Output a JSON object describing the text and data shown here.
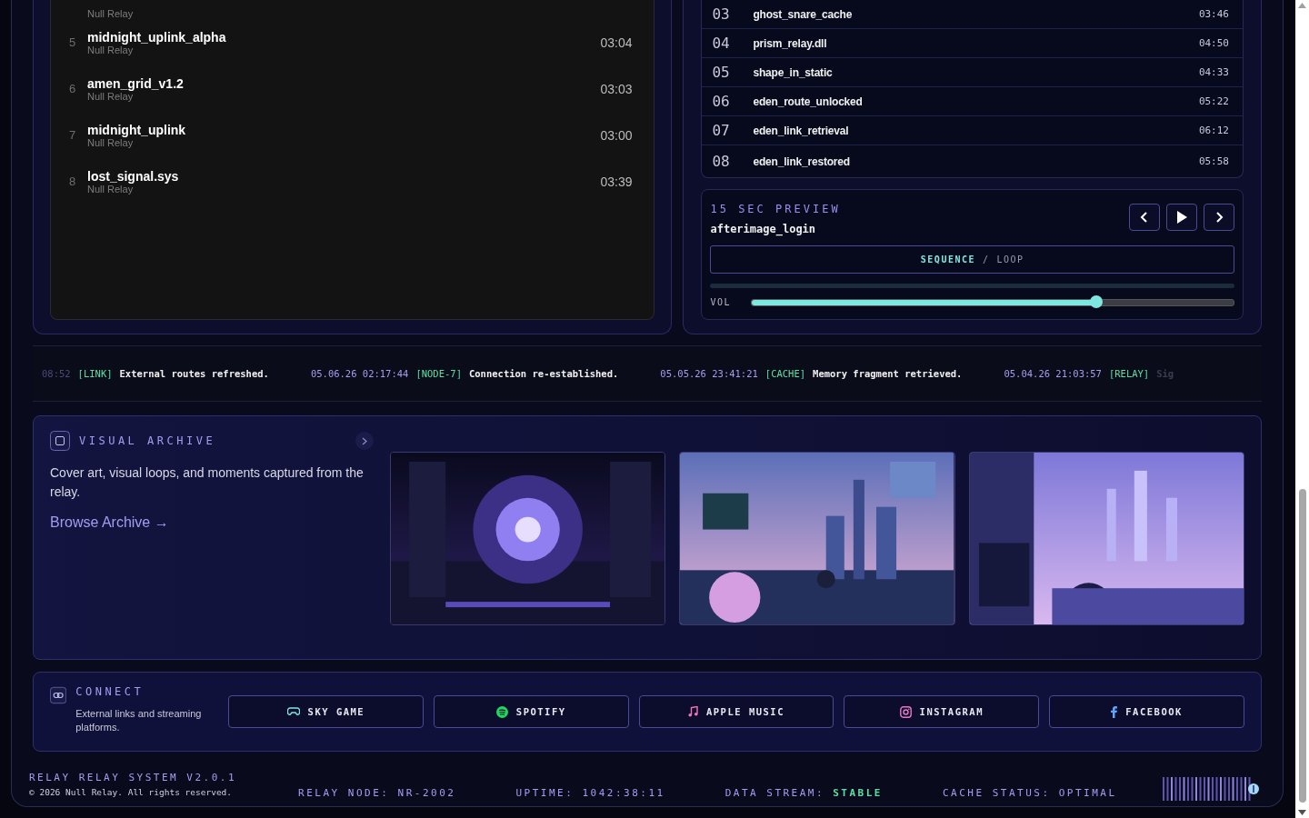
{
  "library": {
    "cut_row": {
      "artist": "Null Relay"
    },
    "tracks": [
      {
        "number": "5",
        "title": "midnight_uplink_alpha",
        "artist": "Null Relay",
        "duration": "03:04"
      },
      {
        "number": "6",
        "title": "amen_grid_v1.2",
        "artist": "Null Relay",
        "duration": "03:03"
      },
      {
        "number": "7",
        "title": "midnight_uplink",
        "artist": "Null Relay",
        "duration": "03:00"
      },
      {
        "number": "8",
        "title": "lost_signal.sys",
        "artist": "Null Relay",
        "duration": "03:39"
      }
    ]
  },
  "tracklist": [
    {
      "number": "03",
      "title": "ghost_snare_cache",
      "duration": "03:46"
    },
    {
      "number": "04",
      "title": "prism_relay.dll",
      "duration": "04:50"
    },
    {
      "number": "05",
      "title": "shape_in_static",
      "duration": "04:33"
    },
    {
      "number": "06",
      "title": "eden_route_unlocked",
      "duration": "05:22"
    },
    {
      "number": "07",
      "title": "eden_link_retrieval",
      "duration": "06:12"
    },
    {
      "number": "08",
      "title": "eden_link_restored",
      "duration": "05:58"
    }
  ],
  "preview": {
    "label": "15 SEC PREVIEW",
    "track": "afterimage_login",
    "modes": [
      {
        "label": "SEQUENCE",
        "selected": true
      },
      {
        "label": "LOOP",
        "selected": false
      }
    ],
    "separator": "/",
    "volume": {
      "label": "VOL",
      "level": 0.715
    }
  },
  "ticker": [
    {
      "time": "08:52",
      "tag": "[LINK]",
      "message": "External routes refreshed."
    },
    {
      "time": "05.06.26 02:17:44",
      "tag": "[NODE-7]",
      "message": "Connection re-established."
    },
    {
      "time": "05.05.26 23:41:21",
      "tag": "[CACHE]",
      "message": "Memory fragment retrieved."
    },
    {
      "time": "05.04.26 21:03:57",
      "tag": "[RELAY]",
      "message": "Sig"
    }
  ],
  "archive": {
    "title": "VISUAL ARCHIVE",
    "description": "Cover art, visual loops, and moments captured from the relay.",
    "link": "Browse Archive →"
  },
  "connect": {
    "title": "CONNECT",
    "description": "External links and streaming platforms.",
    "links": [
      {
        "kind": "gamepad",
        "label": "SKY GAME",
        "color": "#7ee7e0"
      },
      {
        "kind": "spotify",
        "label": "SPOTIFY",
        "color": "#1ed760"
      },
      {
        "kind": "music",
        "label": "APPLE MUSIC",
        "color": "#f472b6"
      },
      {
        "kind": "instagram",
        "label": "INSTAGRAM",
        "color": "#e879c9"
      },
      {
        "kind": "facebook",
        "label": "FACEBOOK",
        "color": "#60a5fa"
      }
    ]
  },
  "footer": {
    "system": "RELAY RELAY SYSTEM V2.0.1",
    "copyright": "© 2026 Null Relay. All rights reserved.",
    "stats": [
      {
        "label": "RELAY NODE:",
        "value": "NR-2002",
        "highlight": false
      },
      {
        "label": "UPTIME:",
        "value": "1042:38:11",
        "highlight": false
      },
      {
        "label": "DATA STREAM:",
        "value": "STABLE",
        "highlight": true
      },
      {
        "label": "CACHE STATUS:",
        "value": "OPTIMAL",
        "highlight": false
      }
    ]
  }
}
